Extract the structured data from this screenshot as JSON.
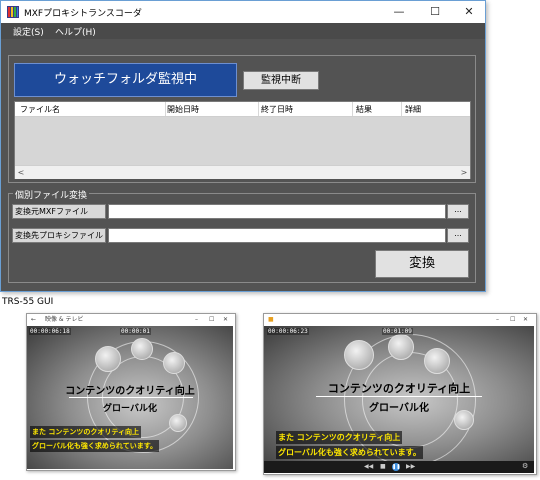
{
  "window": {
    "title": "MXFプロキシトランスコーダ",
    "controls": {
      "minimize": "—",
      "maximize": "☐",
      "close": "✕"
    }
  },
  "menu": {
    "settings": "設定(S)",
    "help": "ヘルプ(H)"
  },
  "monitor": {
    "status_label": "ウォッチフォルダ監視中",
    "stop_button": "監視中断",
    "columns": [
      "ファイル名",
      "開始日時",
      "終了日時",
      "結果",
      "詳細"
    ]
  },
  "individual": {
    "group_title": "個別ファイル変換",
    "source_label": "変換元MXFファイル",
    "source_value": "",
    "dest_label": "変換先プロキシファイル",
    "dest_value": "",
    "browse": "...",
    "convert_button": "変換"
  },
  "caption": "TRS-55 GUI",
  "preview_left": {
    "title": "映像 & テレビ",
    "timecode_left": "00:00:06:18",
    "timecode_center": "00:00:01",
    "caption_main": "コンテンツのクオリティ向上",
    "caption_sub": "グローバル化",
    "subtitle_line1": "また コンテンツのクオリティ向上",
    "subtitle_line2": "グローバル化も強く求められています。"
  },
  "preview_right": {
    "timecode_left": "00:00:06:23",
    "timecode_center": "00:01:09",
    "caption_main": "コンテンツのクオリティ向上",
    "caption_sub": "グローバル化",
    "subtitle_line1": "また コンテンツのクオリティ向上",
    "subtitle_line2": "グローバル化も強く求められています。"
  },
  "colors": {
    "watch_bg": "#1e4a9a",
    "client_bg": "#535353",
    "subtitle_yellow": "#ffe800",
    "play_blue": "#3d8fe0"
  }
}
